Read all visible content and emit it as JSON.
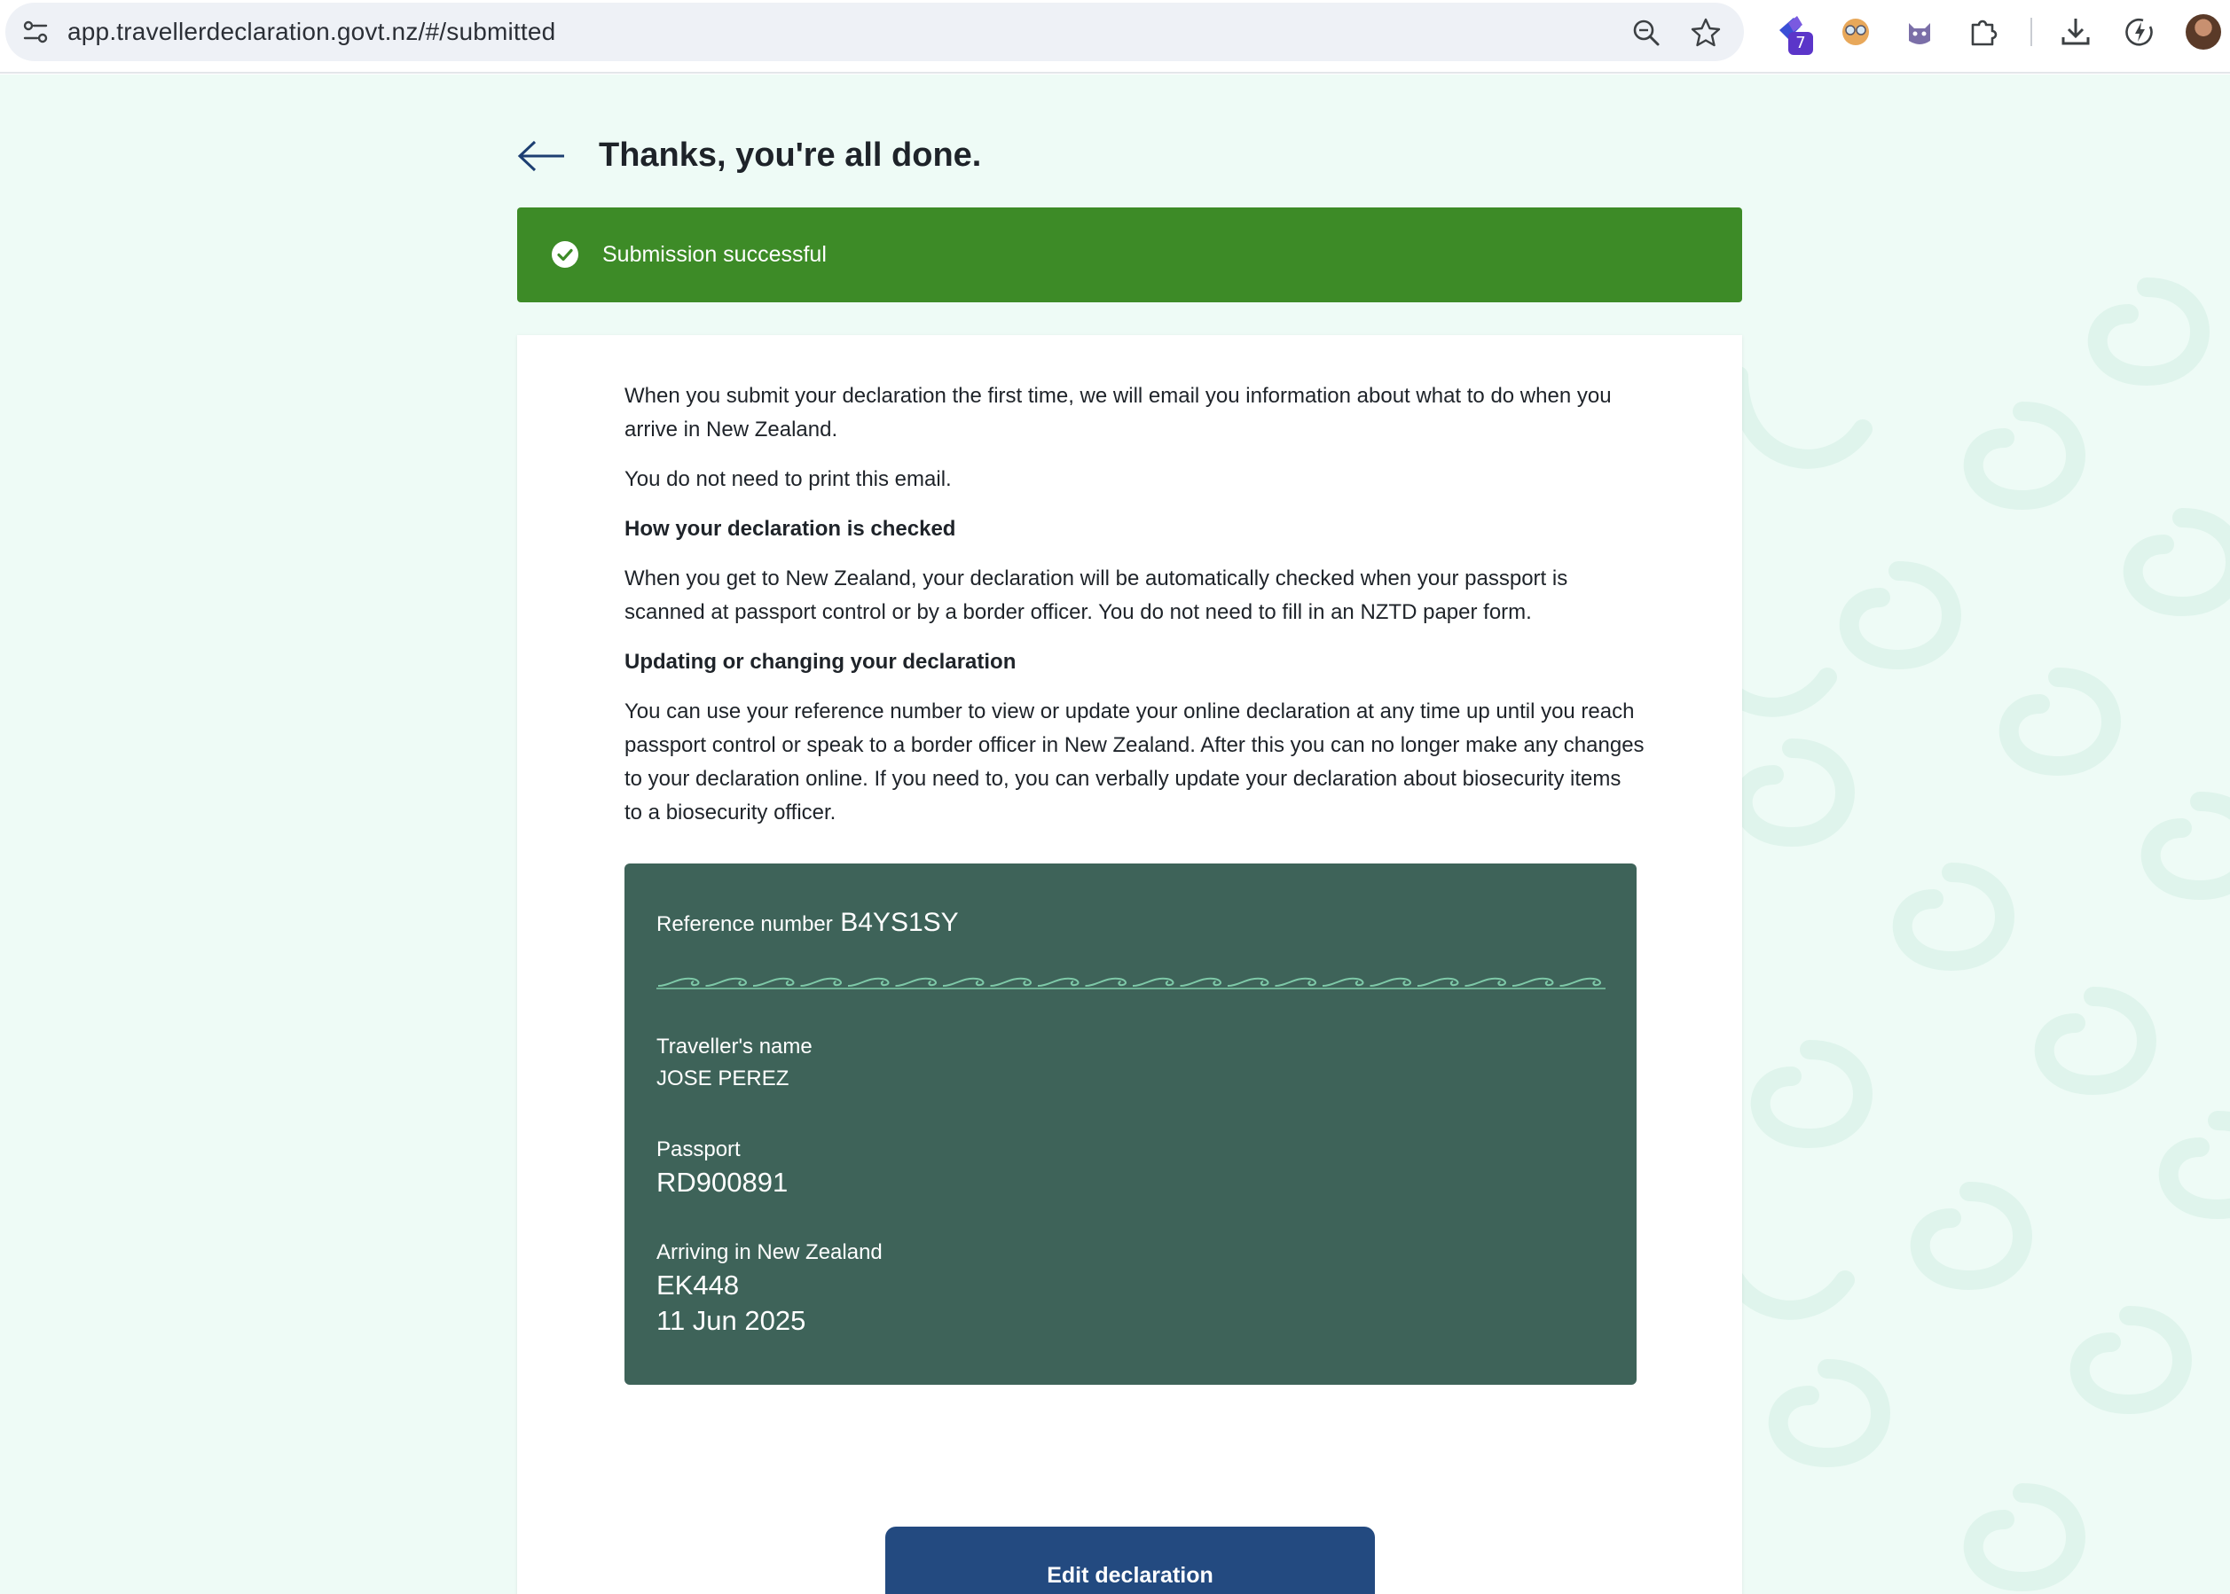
{
  "browser": {
    "url": "app.travellerdeclaration.govt.nz/#/submitted",
    "extension_badge": "7"
  },
  "header": {
    "title": "Thanks, you're all done."
  },
  "banner": {
    "text": "Submission successful",
    "color": "#3d8b27"
  },
  "content": {
    "intro": "When you submit your declaration the first time, we will email you information about what to do when you arrive in New Zealand.",
    "no_print": "You do not need to print this email.",
    "checked_heading": "How your declaration is checked",
    "checked_text": "When you get to New Zealand, your declaration will be automatically checked when your passport is scanned at passport control or by a border officer. You do not need to fill in an NZTD paper form.",
    "updating_heading": "Updating or changing your declaration",
    "updating_text": "You can use your reference number to view or update your online declaration at any time up until you reach passport control or speak to a border officer in New Zealand. After this you can no longer make any changes to your declaration online. If you need to, you can verbally update your declaration about biosecurity items to a biosecurity officer."
  },
  "reference": {
    "label": "Reference number",
    "value": "B4YS1SY",
    "panel_color": "#3e6359",
    "traveller_label": "Traveller's name",
    "traveller_value": "JOSE PEREZ",
    "passport_label": "Passport",
    "passport_value": "RD900891",
    "arriving_label": "Arriving in New Zealand",
    "flight": "EK448",
    "date": "11 Jun 2025"
  },
  "actions": {
    "edit_label": "Edit declaration",
    "button_color": "#234a80"
  },
  "icons": [
    "site-info-icon",
    "zoom-icon",
    "bookmark-star-icon",
    "extension-icon",
    "download-icon",
    "performance-icon",
    "back-arrow-icon",
    "check-circle-icon"
  ]
}
